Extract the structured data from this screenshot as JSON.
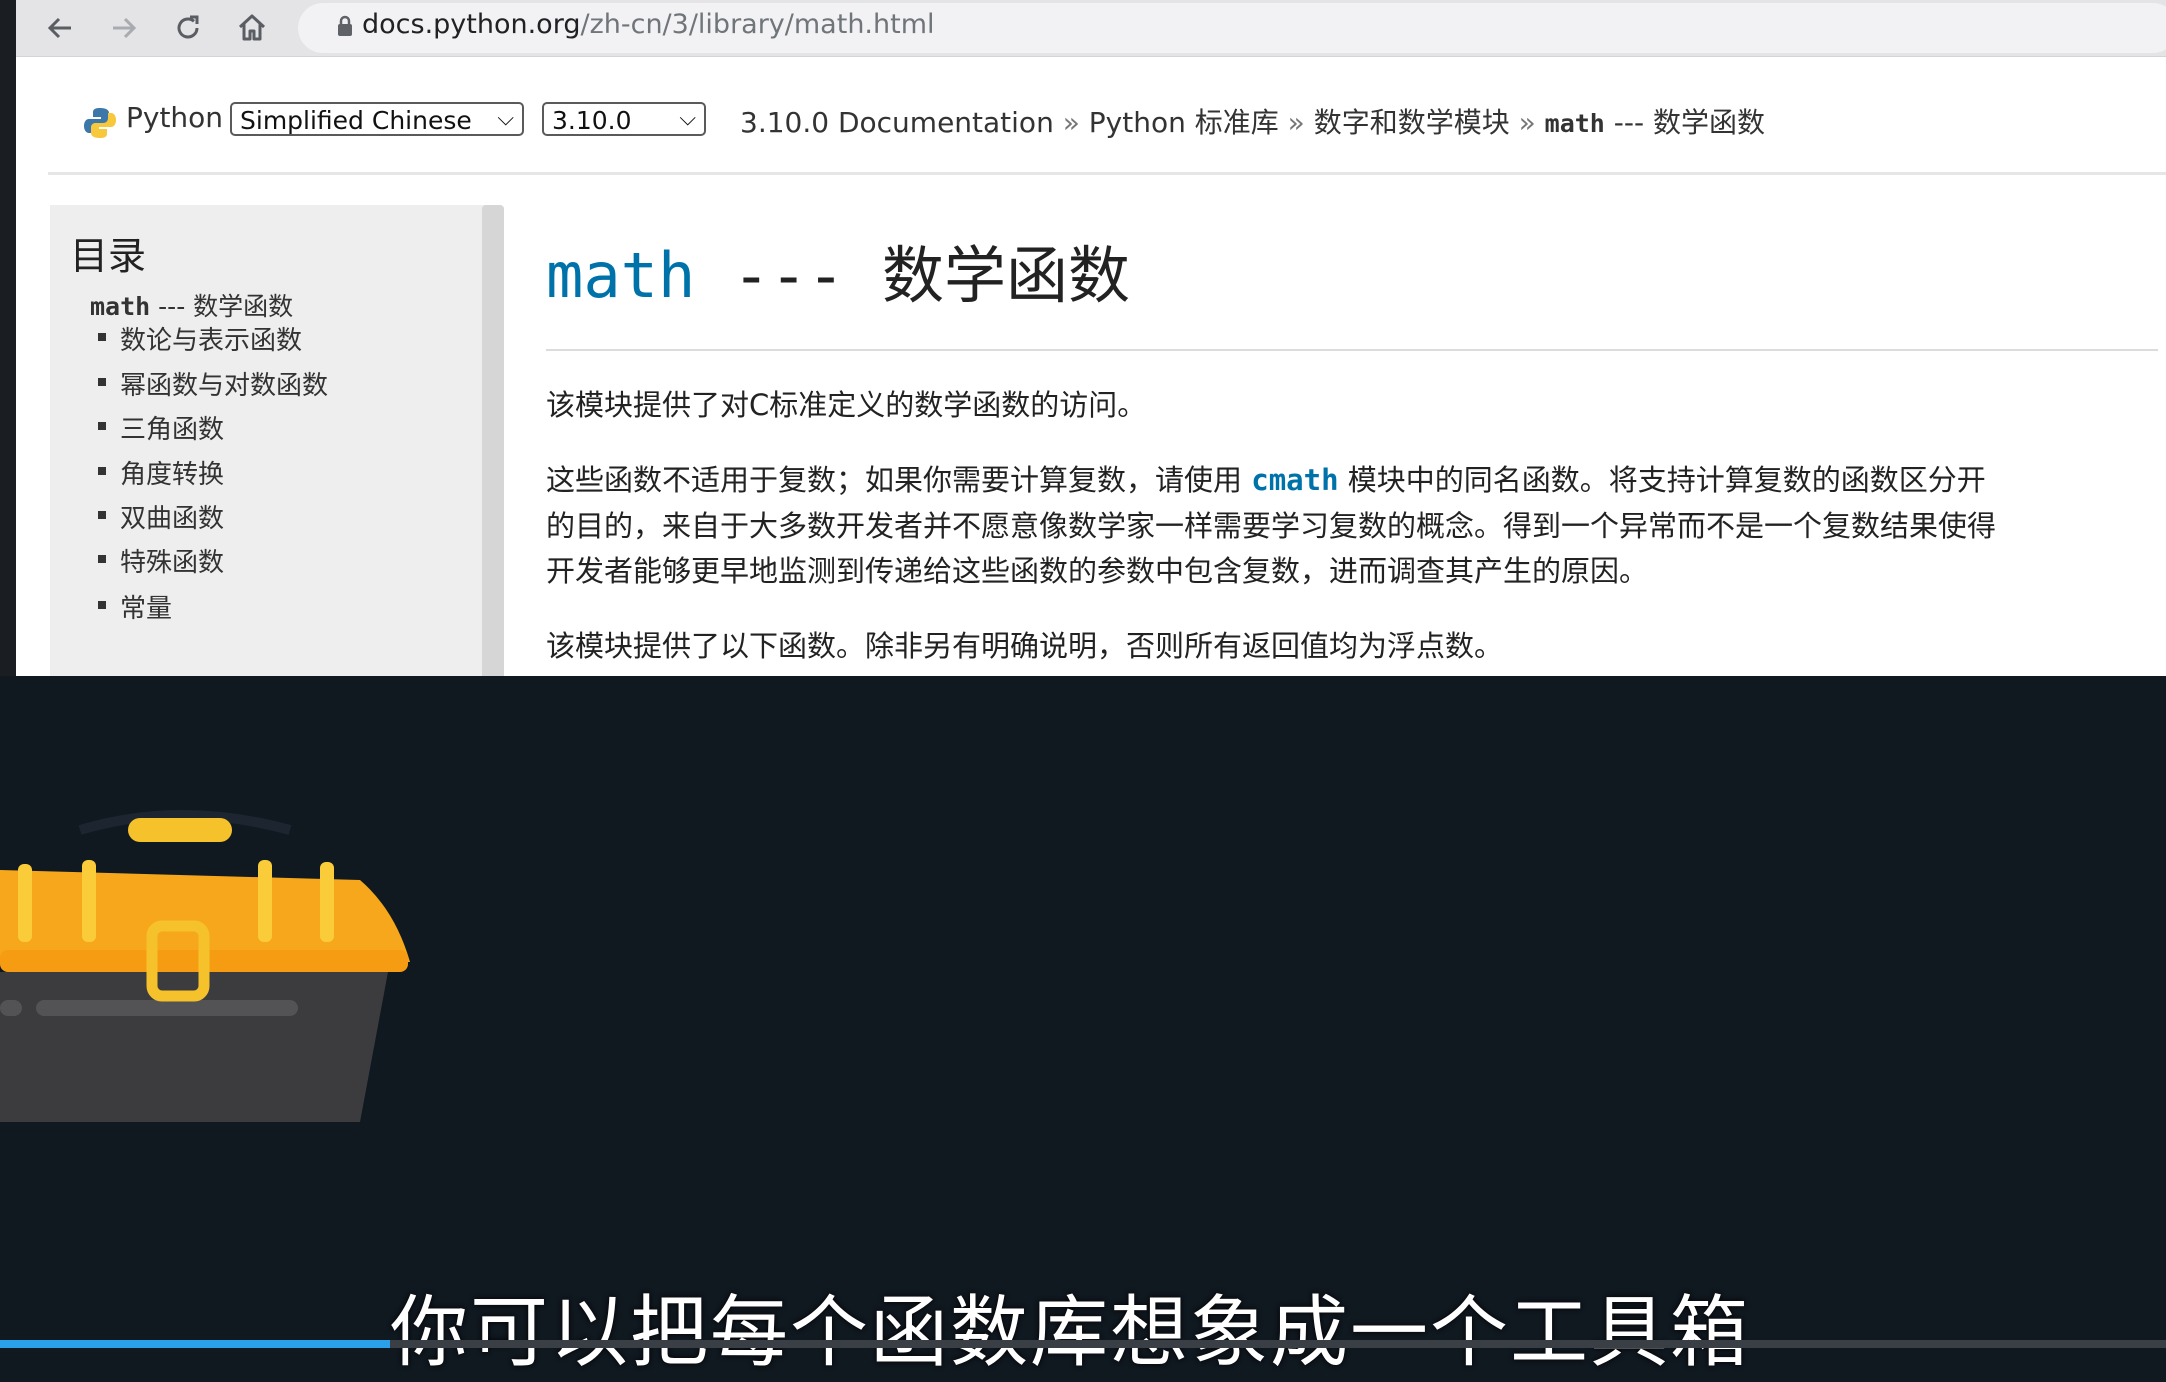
{
  "browser": {
    "url_host": "docs.python.org",
    "url_path": "/zh-cn/3/library/math.html"
  },
  "related": {
    "home": "Python",
    "sep": "»",
    "language_select": "Simplified Chinese",
    "version_select": "3.10.0",
    "crumbs": [
      "3.10.0 Documentation",
      "Python 标准库",
      "数字和数学模块"
    ],
    "current_code": "math",
    "current_rest": " --- 数学函数"
  },
  "toc": {
    "title": "目录",
    "root_code": "math",
    "root_rest": " --- 数学函数",
    "items": [
      "数论与表示函数",
      "幂函数与对数函数",
      "三角函数",
      "角度转换",
      "双曲函数",
      "特殊函数",
      "常量"
    ]
  },
  "main": {
    "title_code": "math",
    "title_dash": " --- ",
    "title_rest": "数学函数",
    "p1": "该模块提供了对C标准定义的数学函数的访问。",
    "p2a": "这些函数不适用于复数；如果你需要计算复数，请使用 ",
    "p2_code": "cmath",
    "p2b": " 模块中的同名函数。将支持计算复数的函数区分开",
    "p2_line2": "的目的，来自于大多数开发者并不愿意像数学家一样需要学习复数的概念。得到一个异常而不是一个复数结果使得",
    "p2_line3": "开发者能够更早地监测到传递给这些函数的参数中包含复数，进而调查其产生的原因。",
    "p3": "该模块提供了以下函数。除非另有明确说明，否则所有返回值均为浮点数。"
  },
  "video": {
    "caption": "你可以把每个函数库想象成一个工具箱",
    "progress": 0.18,
    "colors": {
      "progress": "#2aa0e8",
      "toolbox_lid": "#f6a71c",
      "toolbox_body": "#3c3c3e"
    }
  }
}
